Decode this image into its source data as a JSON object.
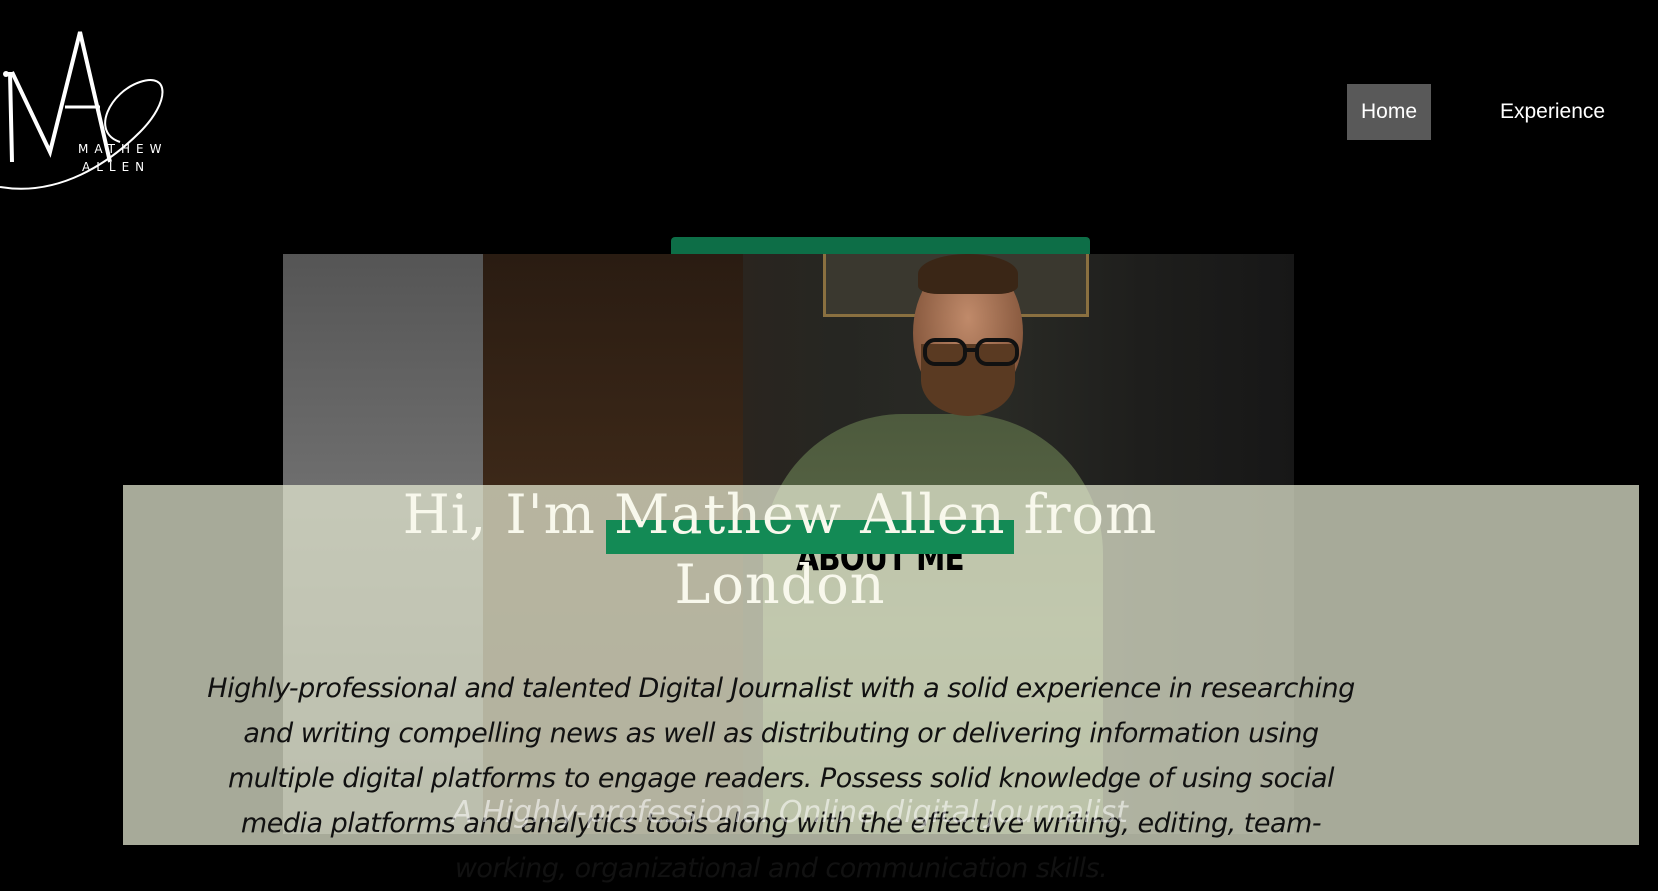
{
  "logo": {
    "monogram": "MA",
    "line1": "MATHEW",
    "line2": "ALLEN"
  },
  "nav": {
    "items": [
      {
        "label": "Home",
        "active": true
      },
      {
        "label": "Experience",
        "active": false
      }
    ]
  },
  "hero": {
    "greeting_prefix": "Hi, I'm",
    "name": "Mathew Allen",
    "greeting_suffix": "from",
    "location": "London",
    "section_label": "ABOUT ME",
    "bio": "Highly-professional and talented Digital Journalist with a solid experience in researching and writing compelling news as well as distributing or delivering information using multiple digital platforms to engage readers. Possess solid knowledge of using social media platforms and analytics tools along with the effective writing, editing, team-working, organizational and communication skills.",
    "tagline": "A Highly-professional Online digital Journalist"
  },
  "colors": {
    "accent_green": "#138a55",
    "tab_green": "#0d6e47",
    "nav_active_bg": "#595959",
    "panel_bg": "#e8ebd4"
  },
  "icons": {
    "logo": "ma-monogram-logo"
  }
}
